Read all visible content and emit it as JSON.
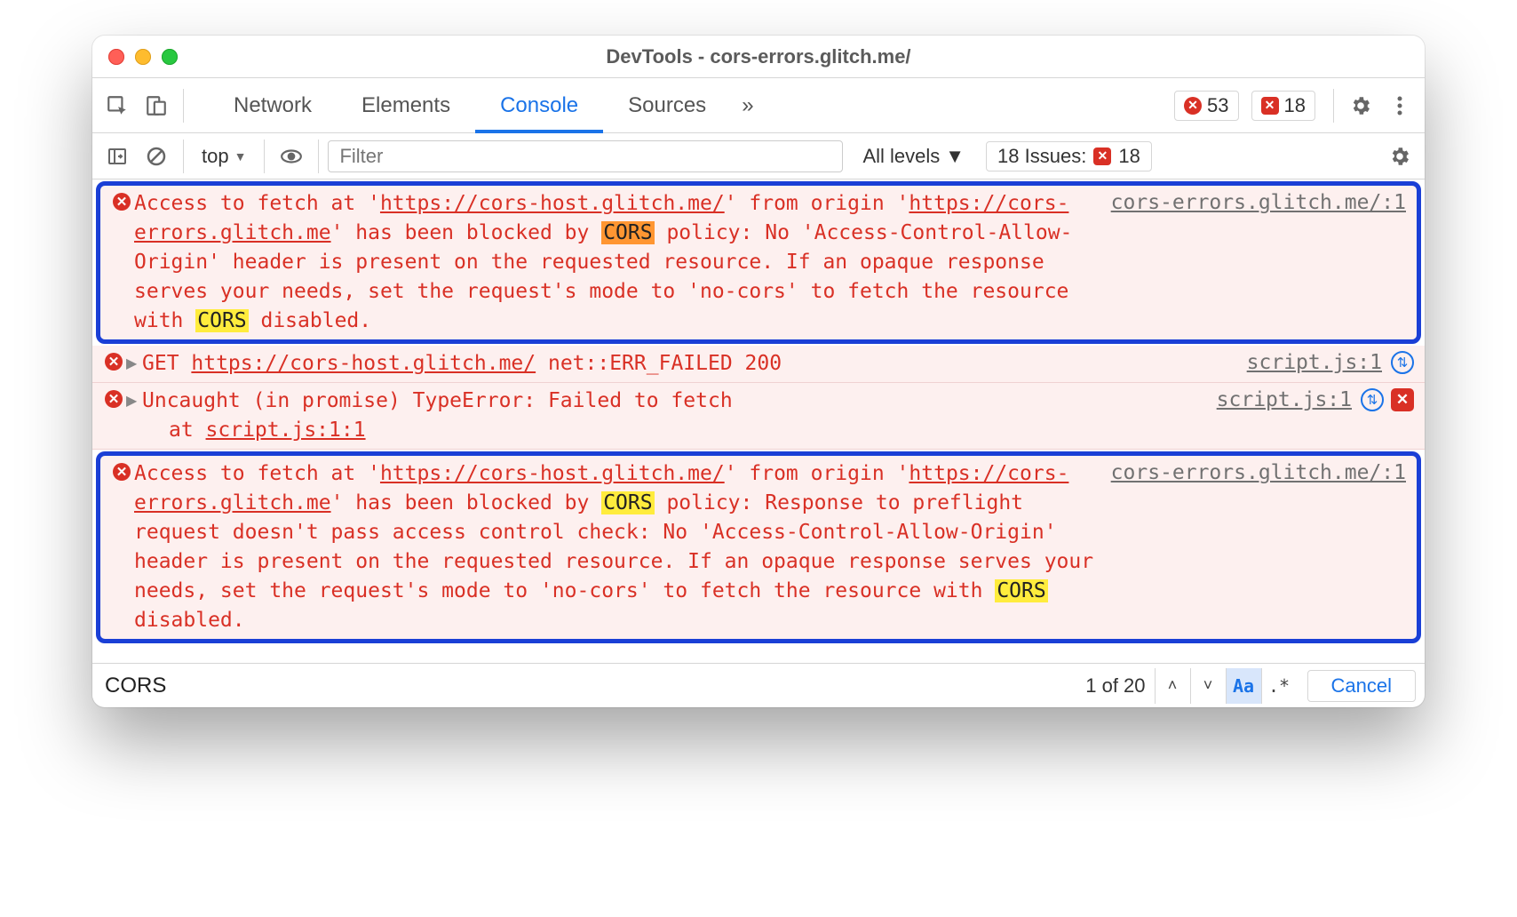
{
  "window": {
    "title": "DevTools - cors-errors.glitch.me/"
  },
  "tabs": {
    "network": "Network",
    "elements": "Elements",
    "console": "Console",
    "sources": "Sources",
    "more": "»"
  },
  "top_badges": {
    "errors_count": "53",
    "issues_count": "18"
  },
  "toolbar": {
    "context": "top",
    "filter_placeholder": "Filter",
    "levels": "All levels",
    "issues_label": "18 Issues:",
    "issues_badge": "18"
  },
  "messages": {
    "m1": {
      "t1": "Access to fetch at '",
      "url1": "https://cors-host.glitch.me/",
      "t2": "' from origin '",
      "url2": "https://cors-errors.glitch.me",
      "t3": "' has been blocked by ",
      "cors1": "CORS",
      "t4": " policy: No 'Access-Control-Allow-Origin' header is present on the requested resource. If an opaque response serves your needs, set the request's mode to 'no-cors' to fetch the resource with ",
      "cors2": "CORS",
      "t5": " disabled.",
      "source": "cors-errors.glitch.me/:1"
    },
    "m2": {
      "t1": "GET ",
      "url": "https://cors-host.glitch.me/",
      "t2": " net::ERR_FAILED 200",
      "source": "script.js:1"
    },
    "m3": {
      "t1": "Uncaught (in promise) TypeError: Failed to fetch",
      "stack_pre": "    at ",
      "stack_link": "script.js:1:1",
      "source": "script.js:1"
    },
    "m4": {
      "t1": "Access to fetch at '",
      "url1": "https://cors-host.glitch.me/",
      "t2": "' from origin '",
      "url2": "https://cors-errors.glitch.me",
      "t3": "' has been blocked by ",
      "cors1": "CORS",
      "t4": " policy: Response to preflight request doesn't pass access control check: No 'Access-Control-Allow-Origin' header is present on the requested resource. If an opaque response serves your needs, set the request's mode to 'no-cors' to fetch the resource with ",
      "cors2": "CORS",
      "t5": " disabled.",
      "source": "cors-errors.glitch.me/:1"
    }
  },
  "search": {
    "query": "CORS",
    "status": "1 of 20",
    "case_label": "Aa",
    "regex_label": ".*",
    "cancel": "Cancel"
  }
}
